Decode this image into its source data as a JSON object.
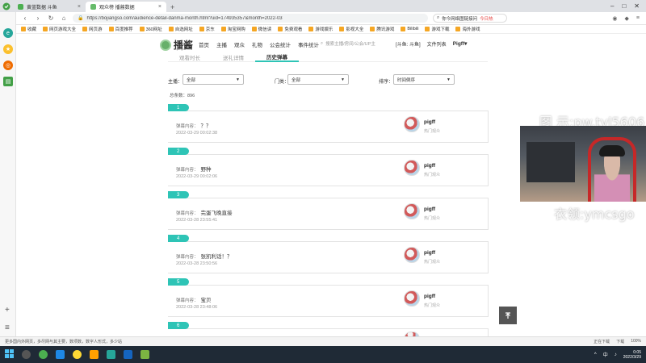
{
  "browser": {
    "tabs": [
      {
        "label": "黄蓝数据 斗鱼"
      },
      {
        "label": "观众榜 播酱数据"
      }
    ],
    "url": "https://bojiangso.com/audience-detail-danma-month.html?uid=174935357&month=2022-03",
    "search_text": "你今网络图链接问",
    "hot_label": "今日热",
    "bookmarks": [
      "收藏",
      "网页游戏大全",
      "网页游",
      "百度推荐",
      "360网址",
      "自选网址",
      "京东",
      "淘宝网购",
      "微信读",
      "免费观看",
      "游戏娱乐",
      "影视大全",
      "腾讯游戏",
      "Bilibili",
      "游戏下载",
      "海外游戏"
    ]
  },
  "site": {
    "logo": "播酱",
    "logo_sub": "bojiangso.com",
    "nav": [
      "首页",
      "主播",
      "观众",
      "礼物",
      "公会统计",
      "事件统计"
    ],
    "search_placeholder": "搜索主播/房间/公会/UP主",
    "user_links": [
      "[斗鱼: 斗鱼]",
      "文件列表",
      "Pigff▾"
    ],
    "subtabs": [
      "观看时长",
      "送礼详情",
      "历史弹幕"
    ]
  },
  "filters": {
    "host_label": "主播：",
    "host_value": "全部",
    "room_label": "门类：",
    "room_value": "全部",
    "sort_label": "排序：",
    "sort_value": "时间倒序"
  },
  "total_label": "总条数：896",
  "items": [
    {
      "num": "1",
      "label": "弹幕内容：",
      "content": "？？",
      "time": "2022-03-29 00:02:38",
      "user": "pigff",
      "role": "热门观众"
    },
    {
      "num": "2",
      "label": "弹幕内容：",
      "content": "野种",
      "time": "2022-03-29 00:02:06",
      "user": "pigff",
      "role": "热门观众"
    },
    {
      "num": "3",
      "label": "弹幕内容：",
      "content": "完蛋飞晚直接",
      "time": "2022-03-28 23:55:41",
      "user": "pigff",
      "role": "热门观众"
    },
    {
      "num": "4",
      "label": "弹幕内容：",
      "content": "张凯利话！？",
      "time": "2022-03-28 23:50:56",
      "user": "pigff",
      "role": "热门观众"
    },
    {
      "num": "5",
      "label": "弹幕内容：",
      "content": "宝贝",
      "time": "2022-03-28 23:48:06",
      "user": "pigff",
      "role": "热门观众"
    },
    {
      "num": "6",
      "label": "",
      "content": "",
      "time": "",
      "user": "",
      "role": ""
    }
  ],
  "overlay": {
    "top_text": "图   示:pw.tyl5606",
    "bottom_text": "衣领:ymcsgo"
  },
  "statusbar": {
    "left": "更多国内外网页，多尽网与其主要，数项数，数字人形式，多少站",
    "right": [
      "正在下载",
      "下载",
      "100%"
    ]
  },
  "taskbar": {
    "time": "0:05",
    "date": "2022/3/29",
    "ime": "中"
  }
}
